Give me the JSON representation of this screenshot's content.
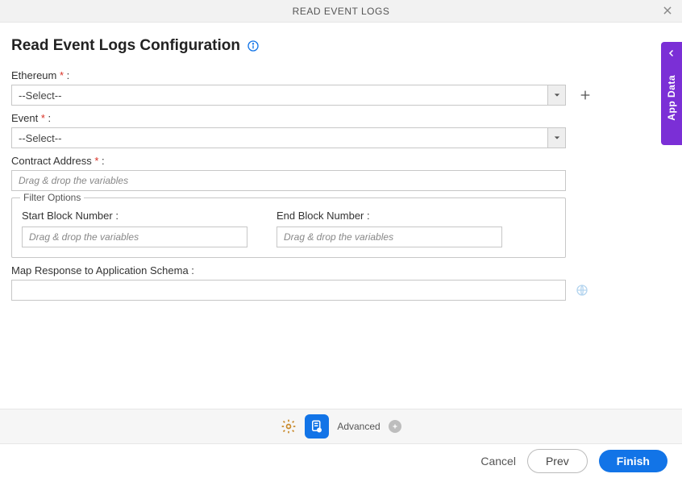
{
  "header": {
    "title": "READ EVENT LOGS"
  },
  "page": {
    "title": "Read Event Logs Configuration"
  },
  "fields": {
    "ethereum": {
      "label": "Ethereum",
      "suffix": " :",
      "value": "--Select--"
    },
    "event": {
      "label": "Event ",
      "suffix": " :",
      "value": "--Select--"
    },
    "contract": {
      "label": "Contract Address ",
      "suffix": " :",
      "placeholder": "Drag & drop the variables"
    },
    "filter": {
      "legend": "Filter Options",
      "start": {
        "label": "Start Block Number :",
        "placeholder": "Drag & drop the variables"
      },
      "end": {
        "label": "End Block Number :",
        "placeholder": "Drag & drop the variables"
      }
    },
    "map": {
      "label": "Map Response to Application Schema :"
    }
  },
  "toolbar": {
    "advanced_label": "Advanced"
  },
  "footer": {
    "cancel": "Cancel",
    "prev": "Prev",
    "finish": "Finish"
  },
  "sidetab": {
    "label": "App Data"
  }
}
